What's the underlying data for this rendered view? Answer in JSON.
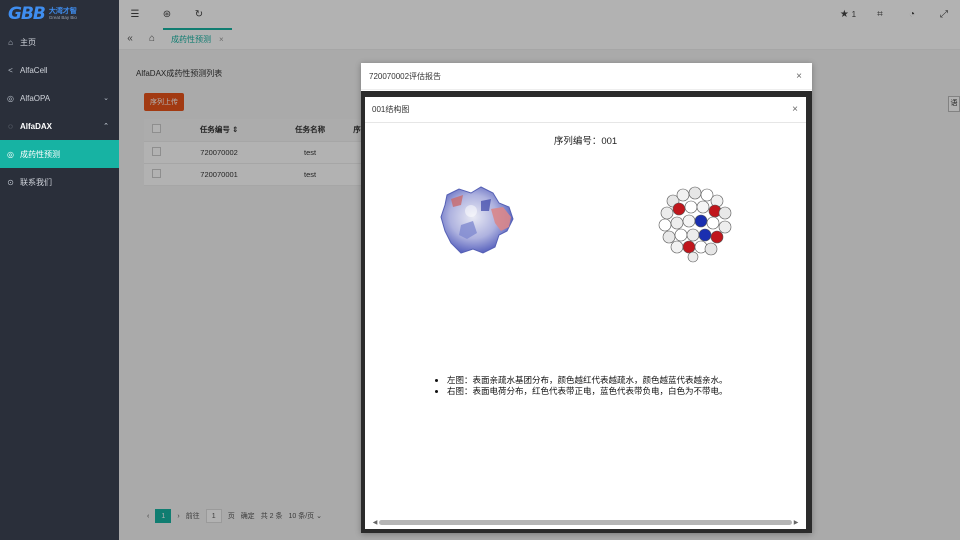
{
  "sidebar": {
    "logo_mark": "GBB",
    "logo_cn": "大湾才智",
    "logo_en": "Great Bay Bio",
    "items": [
      {
        "label": "主页",
        "icon": "⌂"
      },
      {
        "label": "AlfaCell",
        "icon": "<"
      },
      {
        "label": "AlfaOPA",
        "icon": "◎"
      },
      {
        "label": "AlfaDAX",
        "icon": "◌"
      },
      {
        "label": "成药性预测",
        "icon": "◎"
      },
      {
        "label": "联系我们",
        "icon": "⊙"
      }
    ]
  },
  "header": {
    "star_count": "1"
  },
  "tabs": {
    "active_label": "成药性预测"
  },
  "content": {
    "card_title": "AlfaDAX成药性预测列表",
    "upload_label": "序列上传",
    "table": {
      "headers": [
        "任务编号",
        "任务名称",
        "序"
      ],
      "rows": [
        {
          "id": "720070002",
          "name": "test"
        },
        {
          "id": "720070001",
          "name": "test"
        }
      ]
    },
    "pagination": {
      "current": "1",
      "goto_label": "前往",
      "goto_value": "1",
      "page_label": "页",
      "confirm_label": "确定",
      "total_label": "共 2 条",
      "page_size": "10 条/页"
    },
    "side_button": "语"
  },
  "outer_modal": {
    "title": "720070002评估报告"
  },
  "inner_modal": {
    "title": "001结构图",
    "seq_title": "序列编号：001",
    "legend": [
      "左图：表面亲疏水基团分布，颜色越红代表越疏水，颜色越蓝代表越亲水。",
      "右图：表面电荷分布，红色代表带正电，蓝色代表带负电，白色为不带电。"
    ]
  },
  "colors": {
    "accent": "#17b3a3",
    "upload": "#e8541b",
    "sidebar": "#2a2f3a"
  }
}
